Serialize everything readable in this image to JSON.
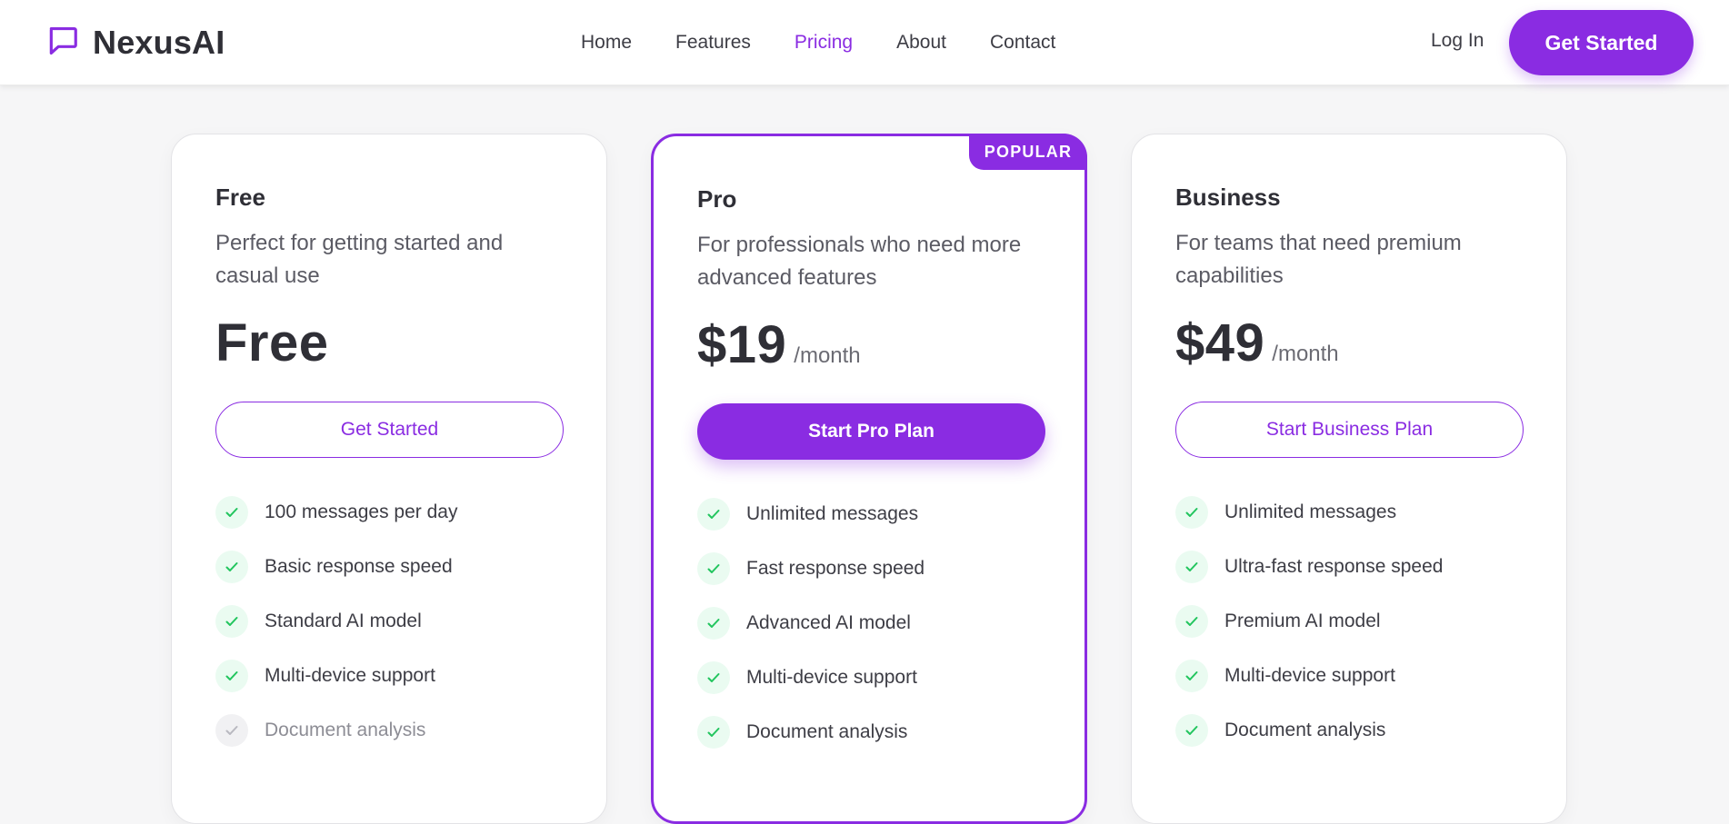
{
  "brand": {
    "name": "NexusAI",
    "accent": "#8a2ce2"
  },
  "nav": {
    "items": [
      "Home",
      "Features",
      "Pricing",
      "About",
      "Contact"
    ],
    "active": "Pricing",
    "login_label": "Log In",
    "cta_label": "Get Started"
  },
  "plans": [
    {
      "name": "Free",
      "description": "Perfect for getting started and casual use",
      "price": "Free",
      "period": "",
      "button_label": "Get Started",
      "button_style": "outline",
      "popular": false,
      "features": [
        {
          "text": "100 messages per day",
          "included": true
        },
        {
          "text": "Basic response speed",
          "included": true
        },
        {
          "text": "Standard AI model",
          "included": true
        },
        {
          "text": "Multi-device support",
          "included": true
        },
        {
          "text": "Document analysis",
          "included": false
        }
      ]
    },
    {
      "name": "Pro",
      "description": "For professionals who need more advanced features",
      "price": "$19",
      "period": "/month",
      "button_label": "Start Pro Plan",
      "button_style": "solid",
      "popular": true,
      "badge": "POPULAR",
      "features": [
        {
          "text": "Unlimited messages",
          "included": true
        },
        {
          "text": "Fast response speed",
          "included": true
        },
        {
          "text": "Advanced AI model",
          "included": true
        },
        {
          "text": "Multi-device support",
          "included": true
        },
        {
          "text": "Document analysis",
          "included": true
        }
      ]
    },
    {
      "name": "Business",
      "description": "For teams that need premium capabilities",
      "price": "$49",
      "period": "/month",
      "button_label": "Start Business Plan",
      "button_style": "outline",
      "popular": false,
      "features": [
        {
          "text": "Unlimited messages",
          "included": true
        },
        {
          "text": "Ultra-fast response speed",
          "included": true
        },
        {
          "text": "Premium AI model",
          "included": true
        },
        {
          "text": "Multi-device support",
          "included": true
        },
        {
          "text": "Document analysis",
          "included": true
        }
      ]
    }
  ]
}
